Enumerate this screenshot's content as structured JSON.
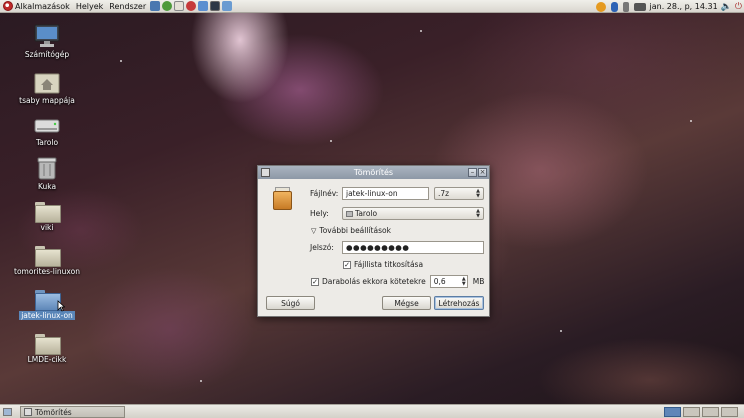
{
  "top_panel": {
    "menus": [
      "Alkalmazások",
      "Helyek",
      "Rendszer"
    ],
    "clock": "jan. 28., p, 14.31"
  },
  "desktop_icons": [
    {
      "label": "Számítógép",
      "icon": "computer-icon"
    },
    {
      "label": "tsaby mappája",
      "icon": "home-folder-icon"
    },
    {
      "label": "Tarolo",
      "icon": "drive-icon"
    },
    {
      "label": "Kuka",
      "icon": "trash-icon"
    },
    {
      "label": "viki",
      "icon": "folder-icon"
    },
    {
      "label": "tomorites-linuxon",
      "icon": "folder-icon"
    },
    {
      "label": "jatek-linux-on",
      "icon": "folder-icon",
      "selected": true
    },
    {
      "label": "LMDE-cikk",
      "icon": "folder-icon"
    }
  ],
  "dialog": {
    "title": "Tömörítés",
    "filename_label": "Fájlnév:",
    "filename_value": "jatek-linux-on",
    "extension": ".7z",
    "location_label": "Hely:",
    "location_value": "Tarolo",
    "expander_label": "További beállítások",
    "password_label": "Jelszó:",
    "password_value": "●●●●●●●●●",
    "encrypt_list_label": "Fájllista titkosítása",
    "encrypt_list_checked": true,
    "split_label": "Darabolás ekkora kötetekre",
    "split_checked": true,
    "split_value": "0,6",
    "split_unit": "MB",
    "help_button": "Súgó",
    "cancel_button": "Mégse",
    "create_button": "Létrehozás"
  },
  "taskbar": {
    "task_label": "Tömörítés"
  }
}
